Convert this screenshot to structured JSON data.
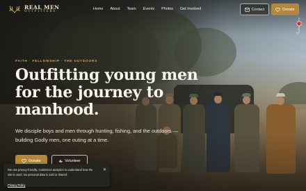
{
  "brand": {
    "title": "REAL MEN",
    "subtitle": "OUTFITTERS",
    "accent_color": "#b5873b"
  },
  "nav": {
    "items": [
      "Home",
      "About",
      "Team",
      "Events",
      "Photos",
      "Get Involved"
    ]
  },
  "header_actions": {
    "contact_label": "Contact",
    "contact_icon": "mail-icon",
    "donate_label": "Donate",
    "donate_icon": "heart-icon"
  },
  "hero": {
    "eyebrow": "FAITH · FELLOWSHIP · THE OUTDOORS",
    "headline_lines": [
      "Outfitting young men",
      "for the journey to",
      "manhood."
    ],
    "lead": "We disciple boys and men through hunting, fishing, and the outdoors — building Godly men, one outing at a time.",
    "donate_label": "Donate",
    "volunteer_label": "Volunteer",
    "volunteer_icon": "hand-icon"
  },
  "cookie_banner": {
    "text": "We use privacy-friendly, cookieless analytics to understand how the site is used. No personal data is sold or shared.",
    "link_label": "Privacy Policy",
    "close_icon": "close-icon"
  }
}
